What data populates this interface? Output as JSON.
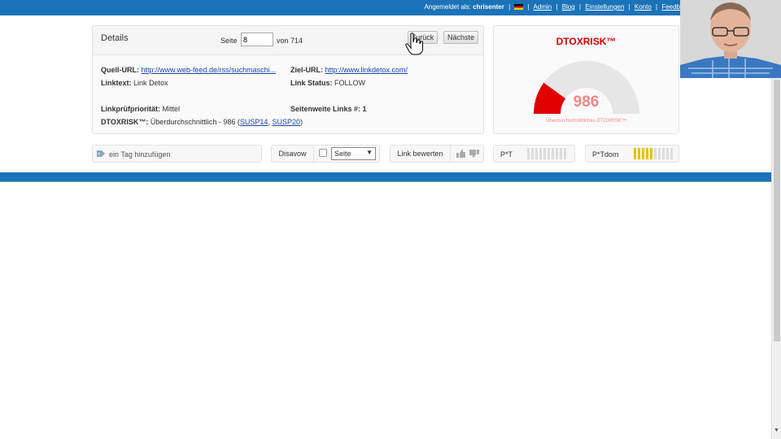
{
  "topbar": {
    "logged_in_prefix": "Angemeldet als:",
    "username": "chrisenter",
    "links": [
      "Admin",
      "Blog",
      "Einstellungen",
      "Konto",
      "Feedb"
    ]
  },
  "details": {
    "title": "Details",
    "page_label": "Seite",
    "page_value": "8",
    "of_label": "von 714",
    "back_button": "Zurück",
    "next_button": "Nächste",
    "source_url_label": "Quell-URL:",
    "source_url": "http://www.web-feed.de/rss/suchmaschi...",
    "target_url_label": "Ziel-URL:",
    "target_url": "http://www.linkdetox.com/",
    "linktext_label": "Linktext:",
    "linktext": "Link Detox",
    "link_status_label": "Link Status:",
    "link_status": "FOLLOW",
    "priority_label": "Linkprüfpriorität:",
    "priority": "Mittel",
    "sitewide_label": "Seitenweite Links #:",
    "sitewide": "1",
    "dtoxrisk_label": "DTOXRISK™:",
    "dtoxrisk_text": "Überdurchschnittlich - 986 (",
    "susp1": "SUSP14",
    "susp_sep": ", ",
    "susp2": "SUSP20",
    "dtoxrisk_close": ")"
  },
  "risk": {
    "title": "DTOXRISK™",
    "value": "986",
    "subtitle": "Überdurchschnittliches DTOXRISK™",
    "gauge_fill_fraction": 0.2,
    "accent_color": "#e00000"
  },
  "toolbar": {
    "tag_placeholder": "ein Tag hinzufügen",
    "disavow_label": "Disavow",
    "disavow_select": "Seite",
    "rate_label": "Link bewerten",
    "pt_label": "P*T",
    "pt_level": 0,
    "ptdom_label": "P*Tdom",
    "ptdom_level": 5,
    "bars_total": 10
  },
  "colors": {
    "brand_blue": "#1a73b8",
    "bar_active": "#e8c000"
  }
}
